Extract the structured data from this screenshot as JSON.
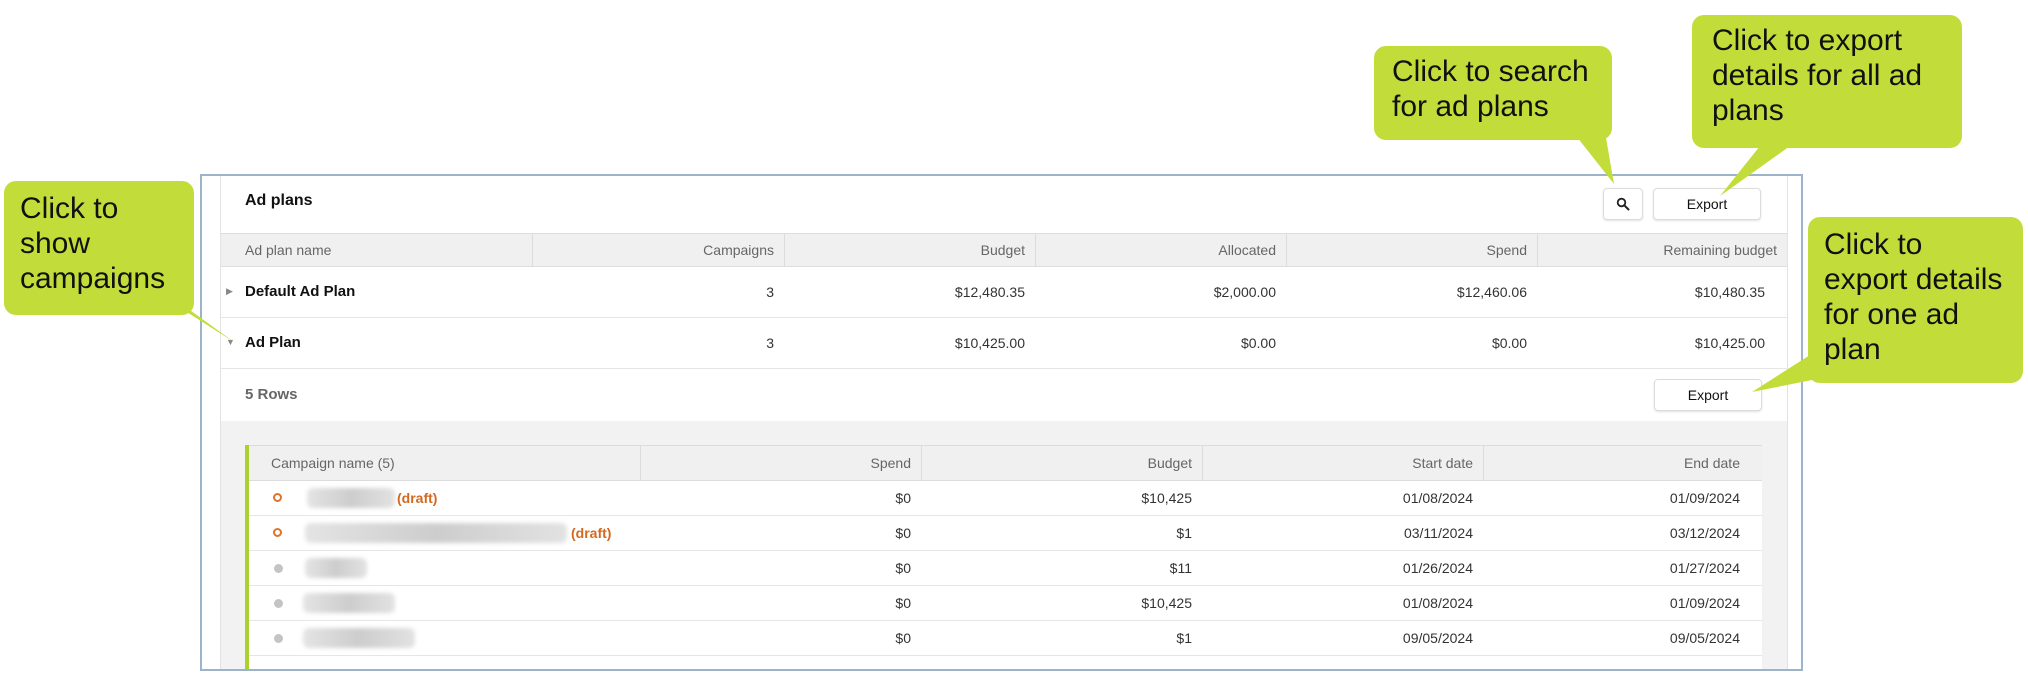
{
  "panel": {
    "title": "Ad plans",
    "search_icon": "search-icon",
    "export_label": "Export"
  },
  "ad_plans_table": {
    "columns": [
      "Ad plan name",
      "Campaigns",
      "Budget",
      "Allocated",
      "Spend",
      "Remaining budget"
    ],
    "rows": [
      {
        "name": "Default Ad Plan",
        "campaigns": "3",
        "budget": "$12,480.35",
        "allocated": "$2,000.00",
        "spend": "$12,460.06",
        "remaining": "$10,480.35",
        "expanded": false
      },
      {
        "name": "Ad Plan",
        "campaigns": "3",
        "budget": "$10,425.00",
        "allocated": "$0.00",
        "spend": "$0.00",
        "remaining": "$10,425.00",
        "expanded": true
      }
    ]
  },
  "expanded_section": {
    "rows_count": "5 Rows",
    "export_label": "Export",
    "columns": [
      "Campaign name (5)",
      "Spend",
      "Budget",
      "Start date",
      "End date"
    ],
    "rows": [
      {
        "status": "draft",
        "draft_label": "(draft)",
        "spend": "$0",
        "budget": "$10,425",
        "start": "01/08/2024",
        "end": "01/09/2024"
      },
      {
        "status": "draft",
        "draft_label": "(draft)",
        "spend": "$0",
        "budget": "$1",
        "start": "03/11/2024",
        "end": "03/12/2024"
      },
      {
        "status": "inactive",
        "spend": "$0",
        "budget": "$11",
        "start": "01/26/2024",
        "end": "01/27/2024"
      },
      {
        "status": "inactive",
        "spend": "$0",
        "budget": "$10,425",
        "start": "01/08/2024",
        "end": "01/09/2024"
      },
      {
        "status": "inactive",
        "spend": "$0",
        "budget": "$1",
        "start": "09/05/2024",
        "end": "09/05/2024"
      }
    ]
  },
  "callouts": {
    "show_campaigns": [
      "Click to",
      "show",
      "campaigns"
    ],
    "search": [
      "Click to search",
      "for ad plans"
    ],
    "export_all": [
      "Click to export",
      "details for all ad",
      "plans"
    ],
    "export_one": [
      "Click to",
      "export details",
      "for one ad",
      "plan"
    ]
  },
  "colors": {
    "callout": "#c2dd3a",
    "draft": "#d2691e",
    "accent_bar": "#a9d12f",
    "frame_border": "#9db3c9"
  }
}
